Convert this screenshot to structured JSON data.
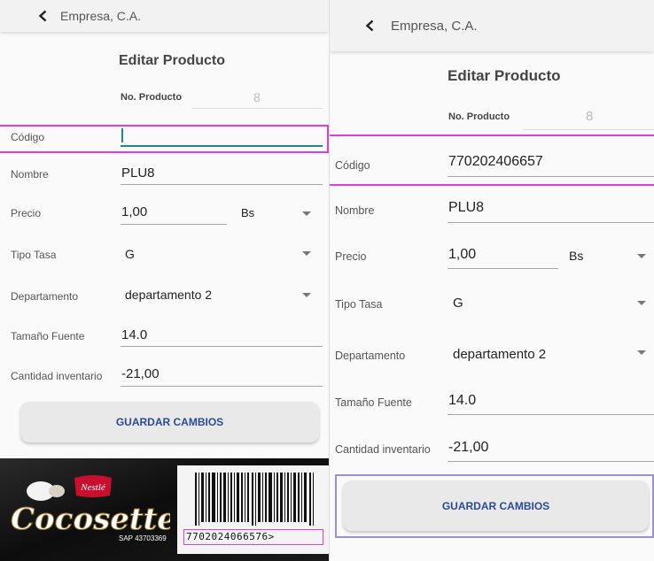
{
  "left": {
    "company": "Empresa, C.A.",
    "heading": "Editar Producto",
    "product_no_label": "No. Producto",
    "product_no_value": "8",
    "fields": {
      "codigo_label": "Código",
      "codigo_value": "",
      "nombre_label": "Nombre",
      "nombre_value": "PLU8",
      "precio_label": "Precio",
      "precio_value": "1,00",
      "moneda_value": "Bs",
      "tipo_tasa_label": "Tipo Tasa",
      "tipo_tasa_value": "G",
      "departamento_label": "Departamento",
      "departamento_value": "departamento 2",
      "tamano_fuente_label": "Tamaño Fuente",
      "tamano_fuente_value": "14.0",
      "cantidad_label": "Cantidad inventario",
      "cantidad_value": "-21,00"
    },
    "save_label": "GUARDAR CAMBIOS"
  },
  "right": {
    "company": "Empresa, C.A.",
    "heading": "Editar Producto",
    "product_no_label": "No. Producto",
    "product_no_value": "8",
    "fields": {
      "codigo_label": "Código",
      "codigo_value": "770202406657",
      "nombre_label": "Nombre",
      "nombre_value": "PLU8",
      "precio_label": "Precio",
      "precio_value": "1,00",
      "moneda_value": "Bs",
      "tipo_tasa_label": "Tipo Tasa",
      "tipo_tasa_value": "G",
      "departamento_label": "Departamento",
      "departamento_value": "departamento 2",
      "tamano_fuente_label": "Tamaño Fuente",
      "tamano_fuente_value": "14.0",
      "cantidad_label": "Cantidad inventario",
      "cantidad_value": "-21,00"
    },
    "save_label": "GUARDAR CAMBIOS"
  },
  "photo": {
    "brand": "Nestlé",
    "product": "Cocosette",
    "sap_code": "SAP 43703369",
    "barcode_digits": "7702024066576>"
  },
  "colors": {
    "highlight": "#e33be0",
    "focus_teal": "#1d8a7a",
    "button_text": "#2b4a96"
  }
}
